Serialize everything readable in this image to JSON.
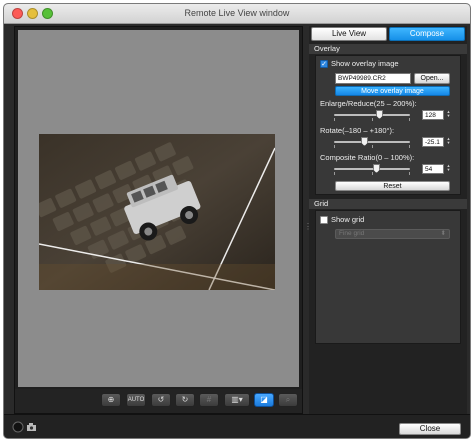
{
  "window": {
    "title": "Remote Live View window"
  },
  "mode_tabs": {
    "live_view": "Live View",
    "compose": "Compose",
    "selected": "Compose"
  },
  "overlay": {
    "section_title": "Overlay",
    "show_overlay_label": "Show overlay image",
    "show_overlay_checked": true,
    "file_name": "BWP49989.CR2",
    "open_button": "Open...",
    "move_overlay_button": "Move overlay image",
    "enlarge_label": "Enlarge/Reduce(25 – 200%):",
    "enlarge_value": "128",
    "enlarge_level": 128,
    "rotate_label": "Rotate(–180 – +180°):",
    "rotate_value": "-25.1",
    "rotate_level": -25.1,
    "composite_label": "Composite Ratio(0 – 100%):",
    "composite_value": "54",
    "composite_level": 54,
    "reset_button": "Reset"
  },
  "grid": {
    "section_title": "Grid",
    "show_grid_label": "Show grid",
    "show_grid_checked": false,
    "grid_select_value": "Fine grid"
  },
  "preview_toolbar": {
    "buttons": [
      {
        "name": "focus-frame-icon",
        "glyph": "⊕"
      },
      {
        "name": "auto-focus-icon",
        "glyph": "AUTO"
      },
      {
        "name": "rotate-left-icon",
        "glyph": "↺"
      },
      {
        "name": "rotate-right-icon",
        "glyph": "↻"
      },
      {
        "name": "grid-icon",
        "glyph": "#"
      },
      {
        "name": "display-mode-icon",
        "glyph": "▥▾"
      },
      {
        "name": "overlay-compose-icon",
        "glyph": "◪"
      },
      {
        "name": "zoom-icon",
        "glyph": "⌕"
      }
    ]
  },
  "bottom": {
    "close_button": "Close"
  },
  "colors": {
    "accent": "#1a8fe8",
    "preview_bg": "#8c8c8c",
    "panel_bg": "#383838"
  }
}
